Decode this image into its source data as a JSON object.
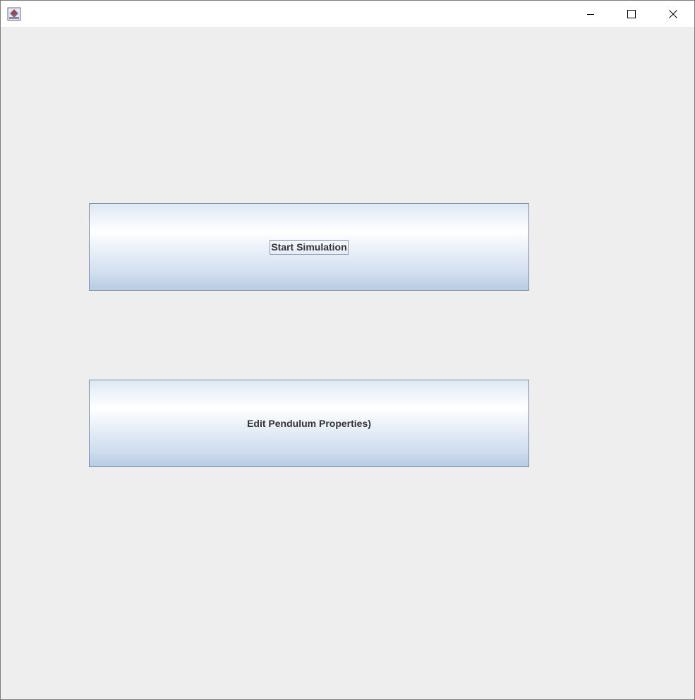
{
  "window": {
    "title": "",
    "controls": {
      "minimize": "minimize-icon",
      "maximize": "maximize-icon",
      "close": "close-icon"
    }
  },
  "buttons": {
    "start_simulation": "Start Simulation",
    "edit_properties": "Edit Pendulum Properties)"
  },
  "colors": {
    "background": "#eeeeee",
    "button_border": "#7a8aa3",
    "button_gradient_top": "#dde8f3",
    "button_gradient_bottom": "#b8cce4",
    "label_text": "#333333"
  }
}
